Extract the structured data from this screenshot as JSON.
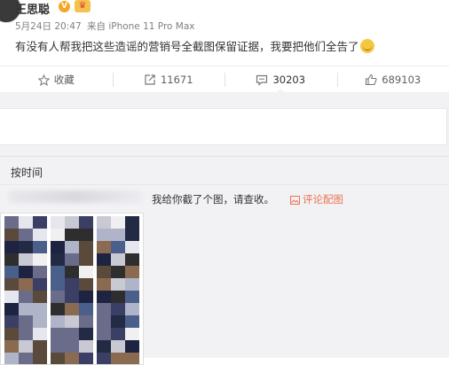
{
  "post": {
    "username": "王思聪",
    "verified_badge": "V",
    "member_badge": "crown-badge",
    "date": "5月24日 20:47",
    "source": "来自 iPhone 11 Pro Max",
    "text": "有没有人帮我把这些造谣的营销号全截图保留证据，我要把他们全告了"
  },
  "actions": {
    "favorite_label": "收藏",
    "repost_count": "11671",
    "comment_count": "30203",
    "like_count": "689103"
  },
  "comments": {
    "sort_label": "按时间",
    "items": [
      {
        "text": "我给你截了个图，请查收。",
        "pic_link": "评论配图"
      }
    ]
  },
  "colors": {
    "accent": "#eb7350",
    "badge_orange": "#f6a623",
    "background_gray": "#f2f2f5"
  },
  "icons": [
    "star-icon",
    "repost-icon",
    "comment-icon",
    "like-icon",
    "picture-icon"
  ]
}
